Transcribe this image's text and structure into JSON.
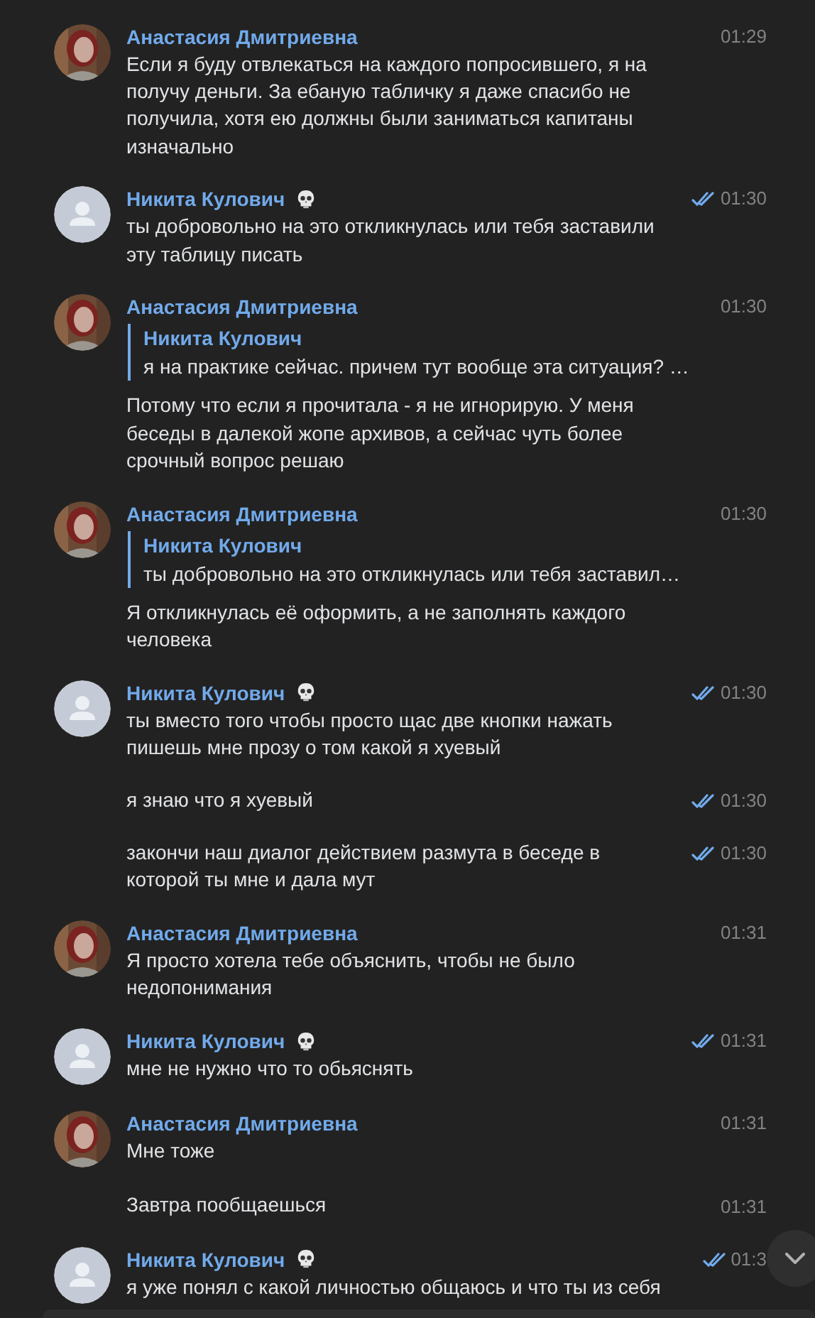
{
  "messages": [
    {
      "author": "Анастасия Дмитриевна",
      "time": "01:29",
      "read": false,
      "text": "Если я буду отвлекаться на каждого попросившего, я на получу деньги. За ебаную табличку я даже спасибо не получила, хотя ею должны были заниматься капитаны изначально"
    },
    {
      "author": "Никита Кулович",
      "avatar": {
        "kind": "default"
      },
      "skull": true,
      "time": "01:30",
      "read": true,
      "text": "ты добровольно на это откликнулась или тебя заставили эту таблицу писать"
    },
    {
      "author": "Анастасия Дмитриевна",
      "time": "01:30",
      "read": false,
      "quote": {
        "author": "Никита Кулович",
        "text": "я на практике сейчас. причем тут вообще эта ситуация? …"
      },
      "text": "Потому что если я прочитала - я не игнорирую. У меня беседы в далекой жопе архивов, а сейчас чуть более срочный вопрос решаю"
    },
    {
      "author": "Анастасия Дмитриевна",
      "time": "01:30",
      "read": false,
      "quote": {
        "author": "Никита Кулович",
        "text": "ты добровольно на это откликнулась или тебя заставил…"
      },
      "text": "Я откликнулась её оформить, а не заполнять каждого человека"
    },
    {
      "author": "Никита Кулович",
      "avatar": {
        "kind": "default"
      },
      "skull": true,
      "time": "01:30",
      "read": true,
      "text": "ты вместо того чтобы просто щас две кнопки нажать пишешь мне прозу о том какой я хуевый"
    },
    {
      "time": "01:30",
      "read": true,
      "text": "я знаю что я хуевый"
    },
    {
      "time": "01:30",
      "read": true,
      "text": "закончи наш диалог действием размута в беседе в которой ты мне и дала мут"
    },
    {
      "author": "Анастасия Дмитриевна",
      "time": "01:31",
      "read": false,
      "text": "Я просто хотела тебе объяснить, чтобы не было недопонимания"
    },
    {
      "author": "Никита Кулович",
      "avatar": {
        "kind": "default"
      },
      "skull": true,
      "time": "01:31",
      "read": true,
      "text": "мне не нужно что то обьяснять"
    },
    {
      "author": "Анастасия Дмитриевна",
      "time": "01:31",
      "read": false,
      "text": "Мне тоже"
    },
    {
      "time": "01:31",
      "read": false,
      "text": "Завтра пообщаешься"
    },
    {
      "author": "Никита Кулович",
      "avatar": {
        "kind": "default"
      },
      "skull": true,
      "time": "01:3",
      "read": true,
      "text": "я уже понял с какой личностью общаюсь и что ты из себя"
    }
  ]
}
